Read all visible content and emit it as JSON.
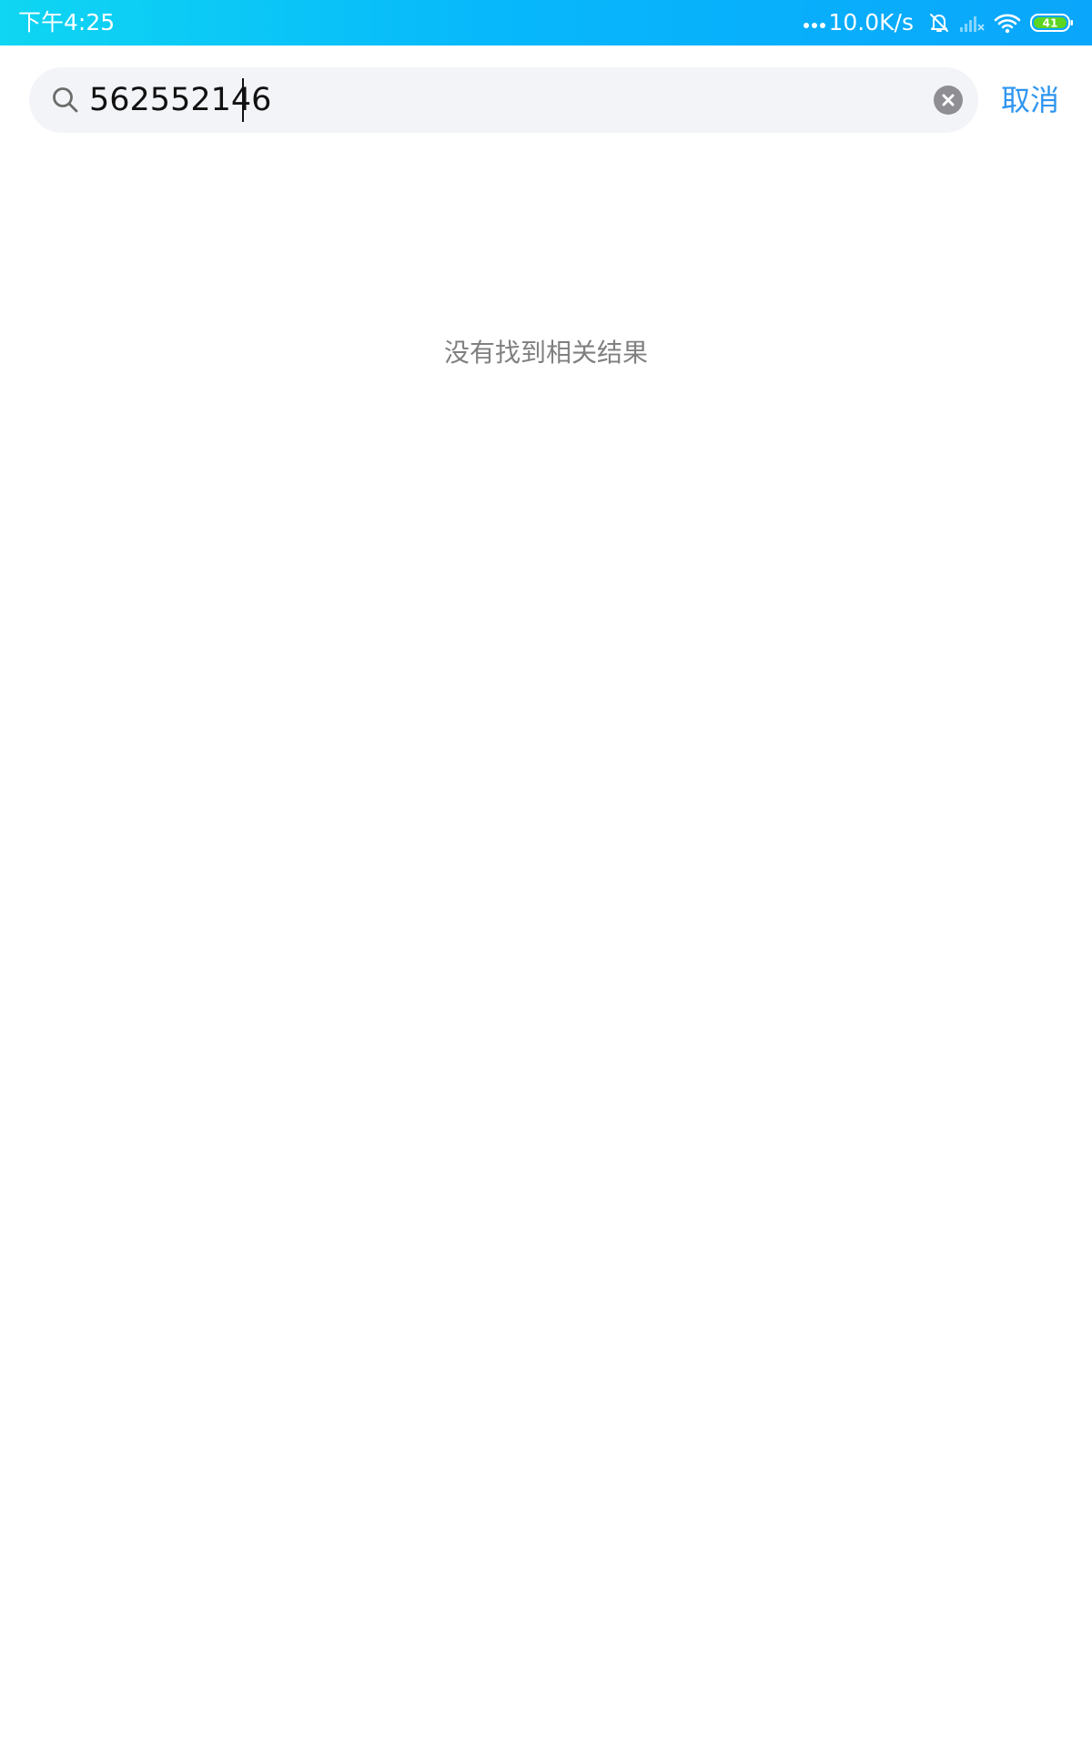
{
  "status_bar": {
    "time": "下午4:25",
    "network_speed": "10.0K/s",
    "battery_level": "41",
    "icons": [
      "more-dots-icon",
      "bell-muted-icon",
      "signal-icon",
      "wifi-icon",
      "battery-icon"
    ],
    "colors": {
      "gradient_start": "#0fd6f2",
      "gradient_end": "#0aa6fb",
      "battery_fill": "#5dd521"
    }
  },
  "search": {
    "query": "562552146",
    "icon": "search-icon",
    "clear_icon": "clear-icon",
    "cancel_label": "取消"
  },
  "results": {
    "empty_message": "没有找到相关结果"
  },
  "colors": {
    "accent": "#2e95ef",
    "search_bg": "#f3f4f8",
    "muted_text": "#808080"
  }
}
